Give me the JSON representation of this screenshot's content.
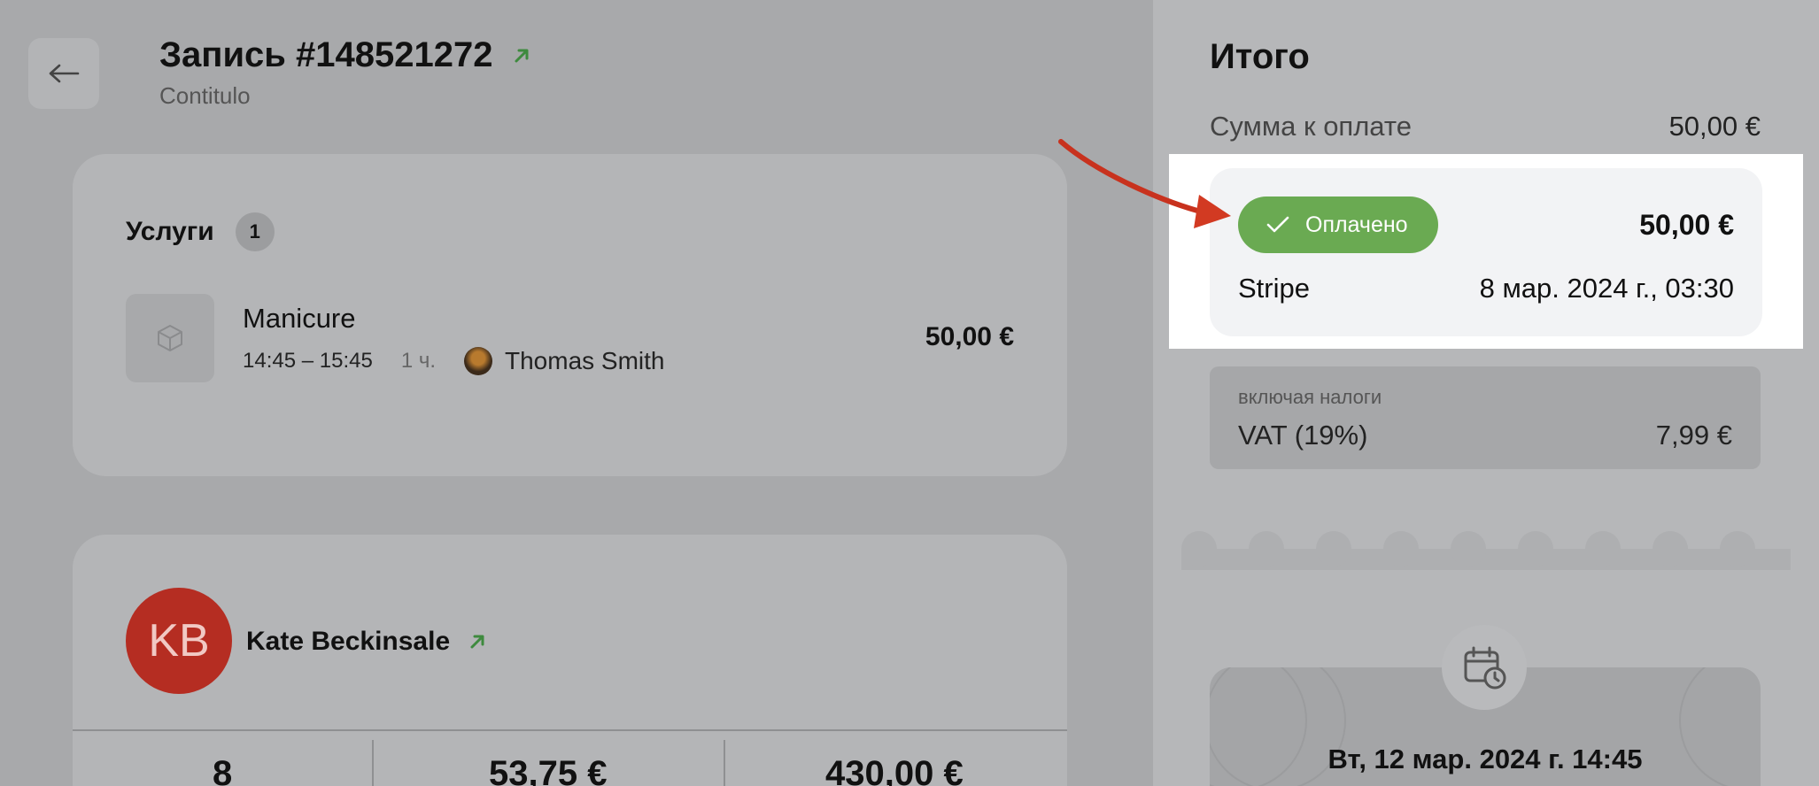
{
  "header": {
    "title": "Запись #148521272",
    "subtitle": "Contitulo",
    "back_icon": "arrow-left-icon",
    "external_icon": "arrow-up-right-icon"
  },
  "services": {
    "heading": "Услуги",
    "count": "1",
    "items": [
      {
        "name": "Manicure",
        "time": "14:45 – 15:45",
        "duration": "1 ч.",
        "staff": "Thomas Smith",
        "price": "50,00 €",
        "icon": "box-icon"
      }
    ]
  },
  "client": {
    "initials": "KB",
    "name": "Kate Beckinsale",
    "avatar_color": "#b52d22",
    "stats": [
      "8",
      "53,75 €",
      "430,00 €"
    ]
  },
  "summary": {
    "title": "Итого",
    "due_label": "Сумма к оплате",
    "due_value": "50,00 €",
    "payment": {
      "status": "Оплачено",
      "status_color": "#6aaa52",
      "amount": "50,00 €",
      "method": "Stripe",
      "date": "8 мар. 2024 г., 03:30"
    },
    "tax": {
      "label": "включая налоги",
      "name": "VAT (19%)",
      "value": "7,99 €"
    },
    "appointment": {
      "icon": "calendar-clock-icon",
      "date": "Вт, 12 мар. 2024 г. 14:45"
    }
  },
  "annotation": {
    "arrow_color": "#c8321e"
  }
}
